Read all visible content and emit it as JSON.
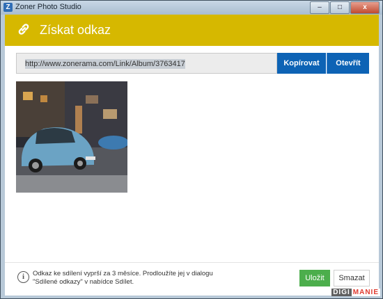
{
  "window": {
    "title": "Zoner Photo Studio",
    "app_icon_glyph": "Z"
  },
  "window_buttons": {
    "minimize": "–",
    "maximize": "□",
    "close": "x"
  },
  "dialog": {
    "title": "Získat odkaz",
    "icon": "link-icon",
    "header_color": "#d6b800"
  },
  "url_field": {
    "value": "http://www.zonerama.com/Link/Album/3763417"
  },
  "buttons": {
    "copy": "Kopírovat",
    "open": "Otevřít",
    "save": "Uložit",
    "delete": "Smazat"
  },
  "info": {
    "icon": "info-icon",
    "line1": "Odkaz ke sdílení vyprší za 3 měsíce. Prodloužíte jej v dialogu",
    "line2": "\"Sdílené odkazy\" v nabídce Sdílet."
  },
  "watermark": {
    "part1": "DIGI",
    "part2": "MANIE"
  },
  "colors": {
    "accent_blue": "#0d63b5",
    "save_green": "#4cae4c"
  }
}
